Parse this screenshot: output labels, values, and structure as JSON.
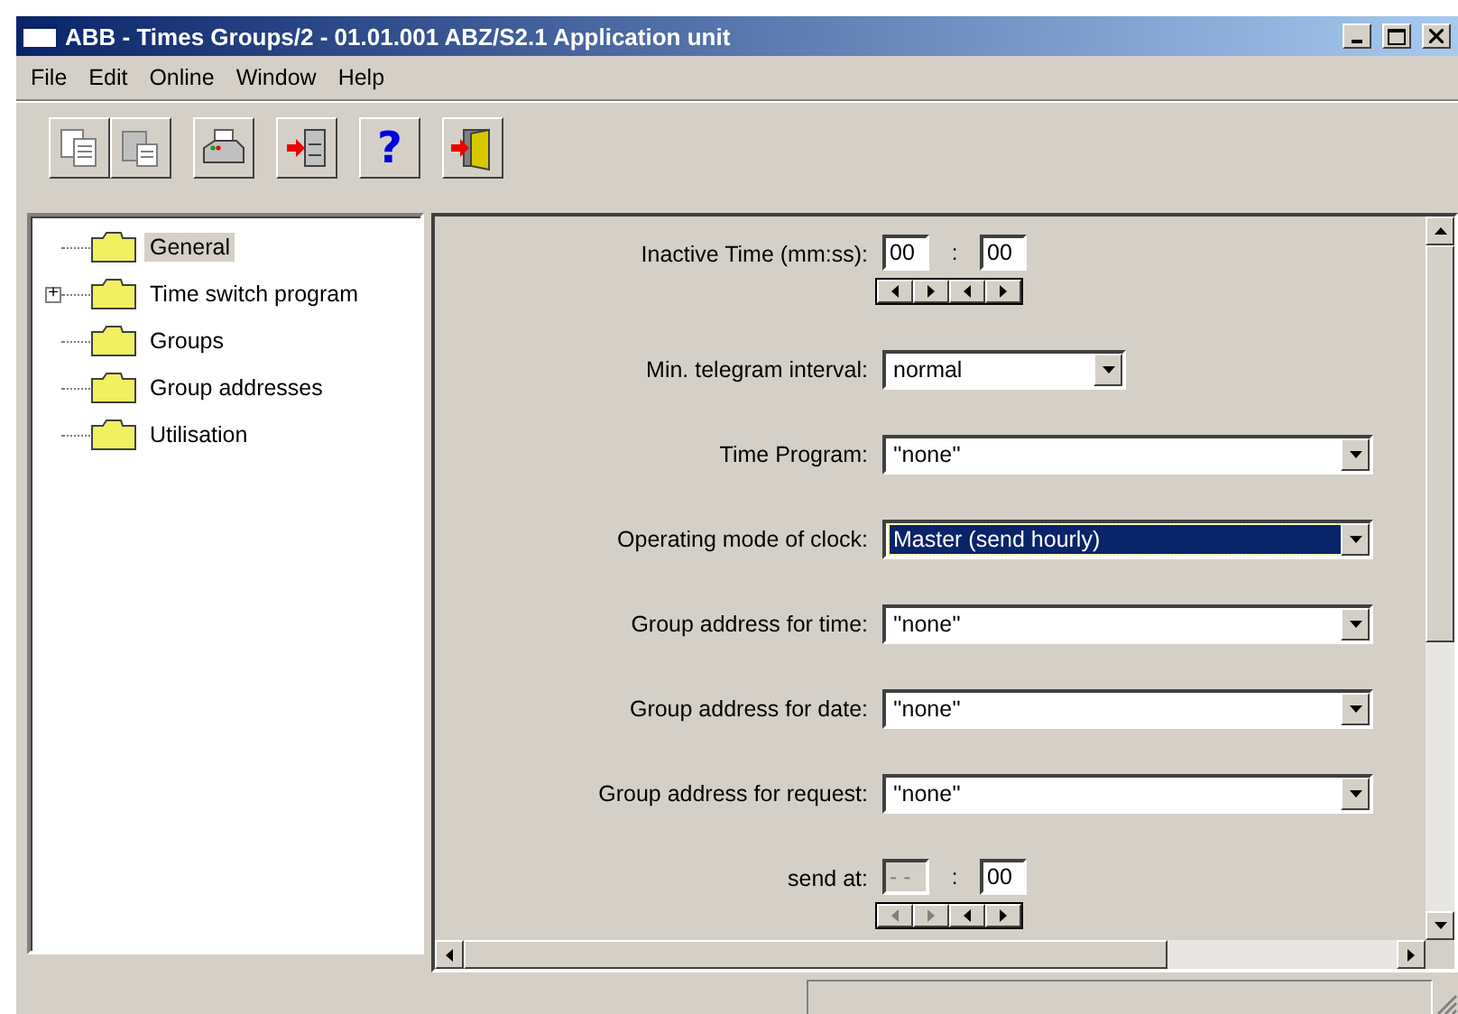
{
  "window": {
    "title": "ABB - Times Groups/2 - 01.01.001 ABZ/S2.1 Application unit",
    "controls": [
      {
        "kind": "minimize"
      },
      {
        "kind": "maximize"
      },
      {
        "kind": "close"
      }
    ]
  },
  "menu": [
    "File",
    "Edit",
    "Online",
    "Window",
    "Help"
  ],
  "toolbar": [
    [
      {
        "kind": "copy"
      },
      {
        "kind": "paste"
      }
    ],
    [
      {
        "kind": "print"
      }
    ],
    [
      {
        "kind": "import"
      }
    ],
    [
      {
        "kind": "help",
        "label": "?"
      }
    ],
    [
      {
        "kind": "exit"
      }
    ]
  ],
  "tree": [
    {
      "label": "General",
      "selected": true,
      "expandable": false
    },
    {
      "label": "Time switch program",
      "selected": false,
      "expandable": true,
      "expander": "+"
    },
    {
      "label": "Groups",
      "selected": false,
      "expandable": false
    },
    {
      "label": "Group addresses",
      "selected": false,
      "expandable": false
    },
    {
      "label": "Utilisation",
      "selected": false,
      "expandable": false
    }
  ],
  "parameters": [
    {
      "kind": "time",
      "label": "Inactive Time (mm:ss):",
      "separator": ":",
      "fields": [
        {
          "value": "00",
          "disabled": false
        },
        {
          "value": "00",
          "disabled": false
        }
      ]
    },
    {
      "kind": "dropdown",
      "label": "Min. telegram interval:",
      "value": "normal",
      "wide": false,
      "selected": false
    },
    {
      "kind": "dropdown",
      "label": "Time Program:",
      "value": "''none''",
      "wide": true,
      "selected": false
    },
    {
      "kind": "dropdown",
      "label": "Operating mode of clock:",
      "value": "Master (send hourly)",
      "wide": true,
      "selected": true
    },
    {
      "kind": "dropdown",
      "label": "Group address for time:",
      "value": "''none''",
      "wide": true,
      "selected": false
    },
    {
      "kind": "dropdown",
      "label": "Group address for date:",
      "value": "''none''",
      "wide": true,
      "selected": false
    },
    {
      "kind": "dropdown",
      "label": "Group address for request:",
      "value": "''none''",
      "wide": true,
      "selected": false
    },
    {
      "kind": "time",
      "label": "send at:",
      "separator": ":",
      "fields": [
        {
          "value": "- -",
          "disabled": true
        },
        {
          "value": "00",
          "disabled": false
        }
      ]
    }
  ]
}
